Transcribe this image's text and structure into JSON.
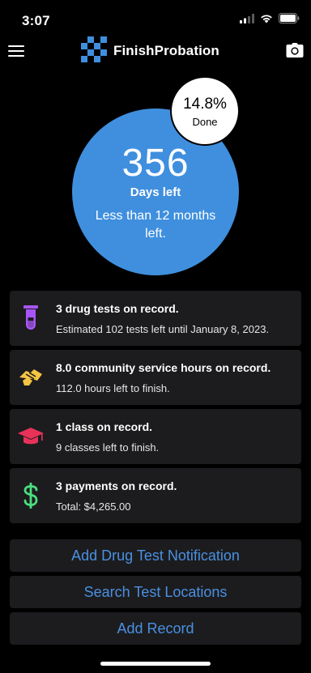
{
  "status_bar": {
    "time": "3:07",
    "icons": [
      "cellular-signal-icon",
      "wifi-icon",
      "battery-icon"
    ]
  },
  "nav": {
    "menu_icon": "hamburger-menu-icon",
    "app_name": "FinishProbation",
    "logo_icon": "checkered-logo-icon",
    "camera_icon": "camera-icon",
    "logo_color": "#3f8fde"
  },
  "progress": {
    "days_left_value": "356",
    "days_left_label": "Days left",
    "time_remaining": "Less than 12 months left.",
    "percent_done": "14.8%",
    "percent_done_value": 14.8,
    "done_label": "Done",
    "circle_color": "#3f8fde"
  },
  "records": [
    {
      "icon": "test-tube-icon",
      "icon_color": "#a855f7",
      "title": "3 drug tests on record.",
      "subtitle": "Estimated 102 tests left until January 8, 2023."
    },
    {
      "icon": "handshake-icon",
      "icon_color": "#f5c542",
      "title": "8.0 community service hours on record.",
      "subtitle": "112.0 hours left to finish."
    },
    {
      "icon": "graduation-cap-icon",
      "icon_color": "#e8325a",
      "title": "1 class on record.",
      "subtitle": "9 classes left to finish."
    },
    {
      "icon": "dollar-sign-icon",
      "icon_color": "#4ade80",
      "title": "3 payments on record.",
      "subtitle": "Total: $4,265.00"
    }
  ],
  "actions": {
    "add_drug_test_notification": "Add Drug Test Notification",
    "search_test_locations": "Search Test Locations",
    "add_record": "Add Record",
    "link_color": "#4a90e2"
  }
}
